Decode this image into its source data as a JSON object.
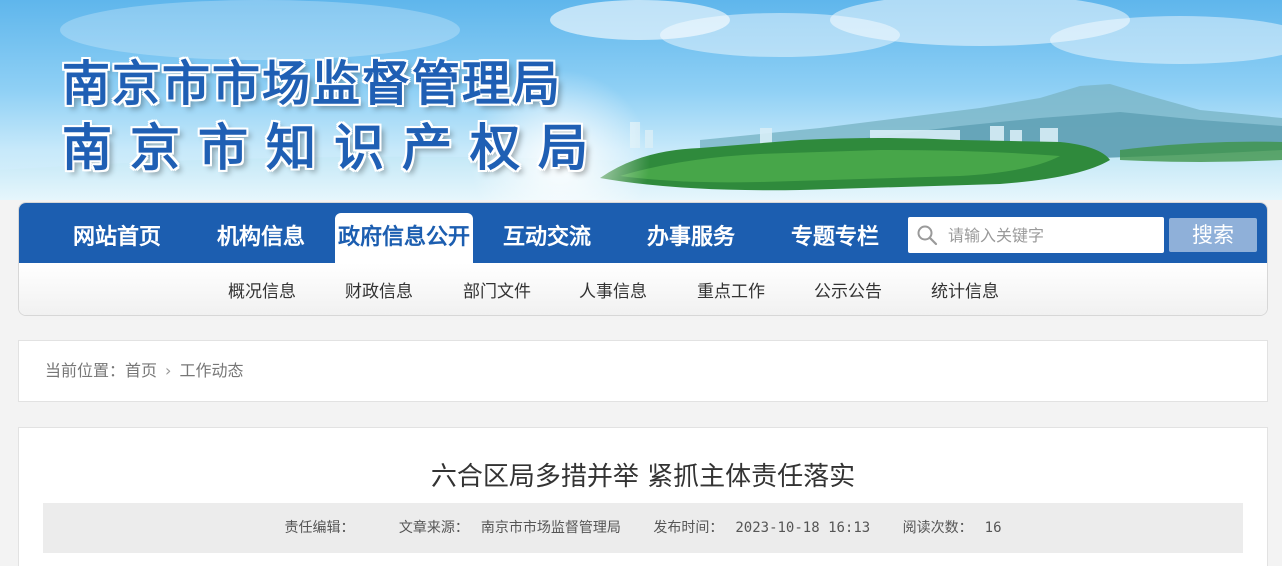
{
  "banner": {
    "title_line1": "南京市市场监督管理局",
    "title_line2": "南京市知识产权局"
  },
  "nav": {
    "main": [
      "网站首页",
      "机构信息",
      "政府信息公开",
      "互动交流",
      "办事服务",
      "专题专栏"
    ],
    "active_index": 2,
    "search_placeholder": "请输入关键字",
    "search_button": "搜索",
    "sub": [
      "概况信息",
      "财政信息",
      "部门文件",
      "人事信息",
      "重点工作",
      "公示公告",
      "统计信息"
    ]
  },
  "breadcrumb": {
    "prefix": "当前位置：",
    "home": "首页",
    "separator": "›",
    "current": "工作动态"
  },
  "article": {
    "title": "六合区局多措并举 紧抓主体责任落实",
    "editor_label": "责任编辑：",
    "editor_value": "",
    "source_label": "文章来源：",
    "source_value": "南京市市场监督管理局",
    "date_label": "发布时间：",
    "date_value": "2023-10-18 16:13",
    "views_label": "阅读次数：",
    "views_value": "16"
  },
  "colors": {
    "nav_blue": "#1c5eb0",
    "search_button": "#8fb0d9",
    "title_blue": "#1f5fb4"
  },
  "icons": [
    "search-icon",
    "chevron-right-icon"
  ]
}
